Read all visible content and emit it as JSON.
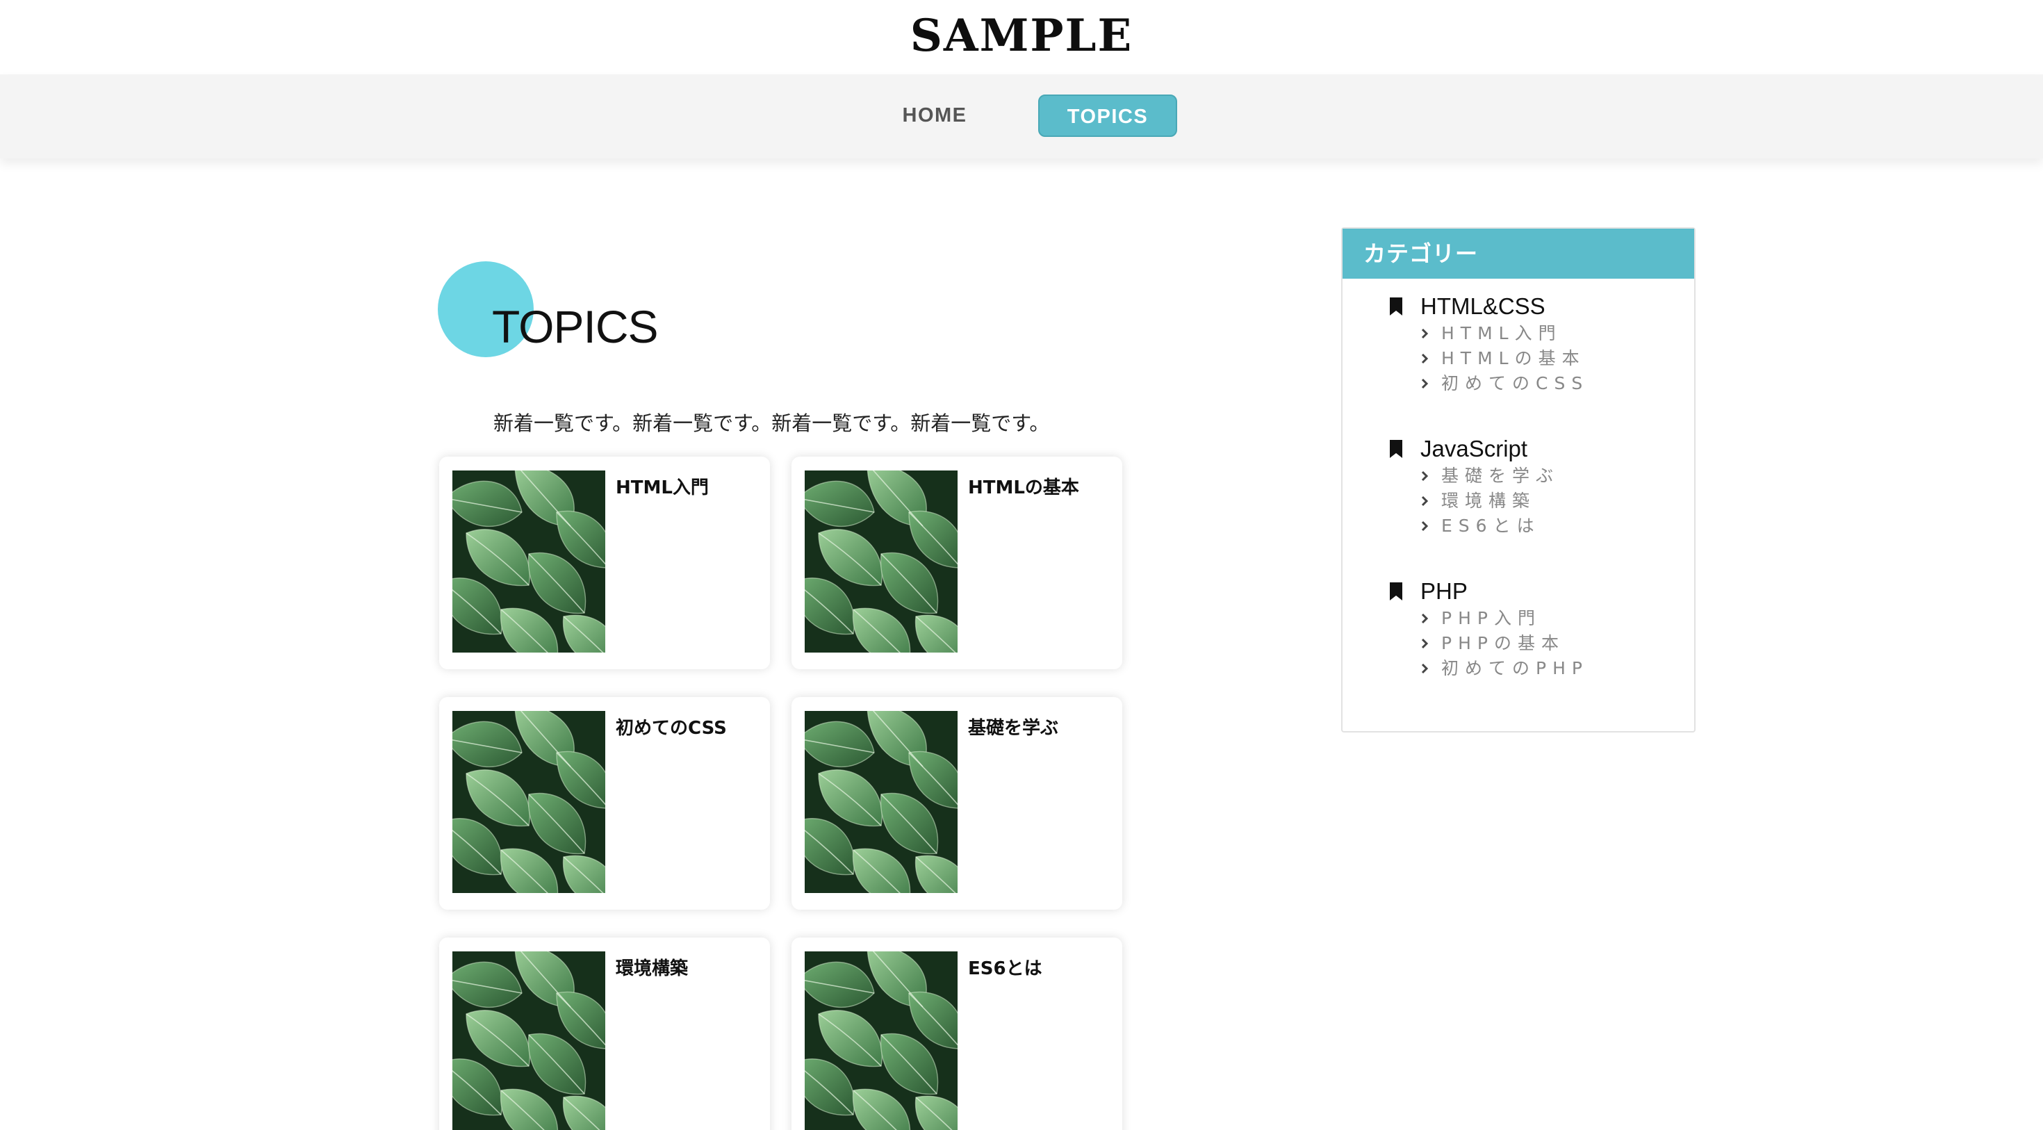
{
  "header": {
    "logo": "SAMPLE"
  },
  "nav": {
    "items": [
      {
        "label": "HOME"
      },
      {
        "label": "TOPICS"
      }
    ],
    "active": "TOPICS"
  },
  "main": {
    "title": "TOPICS",
    "lead": "新着一覧です。新着一覧です。新着一覧です。新着一覧です。",
    "cards": [
      {
        "title": "HTML入門"
      },
      {
        "title": "HTMLの基本"
      },
      {
        "title": "初めてのCSS"
      },
      {
        "title": "基礎を学ぶ"
      },
      {
        "title": "環境構築"
      },
      {
        "title": "ES6とは"
      }
    ]
  },
  "sidebar": {
    "heading": "カテゴリー",
    "categories": [
      {
        "name": "HTML&CSS",
        "items": [
          "HTML入門",
          "HTMLの基本",
          "初めてのCSS"
        ]
      },
      {
        "name": "JavaScript",
        "items": [
          "基礎を学ぶ",
          "環境構築",
          "ES6とは"
        ]
      },
      {
        "name": "PHP",
        "items": [
          "PHP入門",
          "PHPの基本",
          "初めてのPHP"
        ]
      }
    ]
  },
  "colors": {
    "accent": "#5bbccb",
    "circle": "#6dd6e4",
    "nav_bg": "#f4f4f4",
    "sub_text": "#888888"
  },
  "icons": {
    "category": "bookmark-icon",
    "subitem": "chevron-right-icon"
  }
}
